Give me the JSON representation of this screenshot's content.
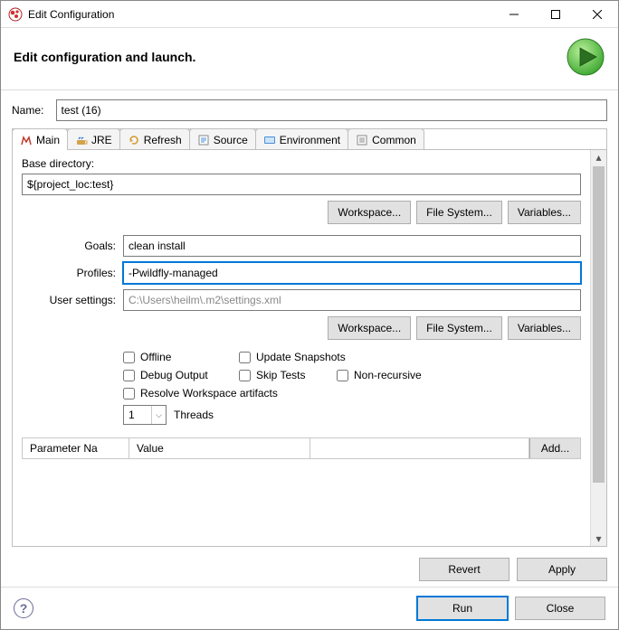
{
  "window": {
    "title": "Edit Configuration",
    "heading": "Edit configuration and launch."
  },
  "labels": {
    "name": "Name:",
    "base_dir": "Base directory:",
    "goals": "Goals:",
    "profiles": "Profiles:",
    "user_settings": "User settings:",
    "threads": "Threads",
    "param_name": "Parameter Na",
    "param_value": "Value"
  },
  "fields": {
    "name": "test (16)",
    "base_dir": "${project_loc:test}",
    "goals": "clean install",
    "profiles": "-Pwildfly-managed",
    "user_settings": "C:\\Users\\heilm\\.m2\\settings.xml",
    "threads": "1"
  },
  "buttons": {
    "workspace": "Workspace...",
    "file_system": "File System...",
    "variables": "Variables...",
    "add": "Add...",
    "revert": "Revert",
    "apply": "Apply",
    "run": "Run",
    "close": "Close"
  },
  "tabs": {
    "main": "Main",
    "jre": "JRE",
    "refresh": "Refresh",
    "source": "Source",
    "environment": "Environment",
    "common": "Common"
  },
  "checkboxes": {
    "offline": "Offline",
    "update_snapshots": "Update Snapshots",
    "debug_output": "Debug Output",
    "skip_tests": "Skip Tests",
    "non_recursive": "Non-recursive",
    "resolve_workspace": "Resolve Workspace artifacts"
  }
}
